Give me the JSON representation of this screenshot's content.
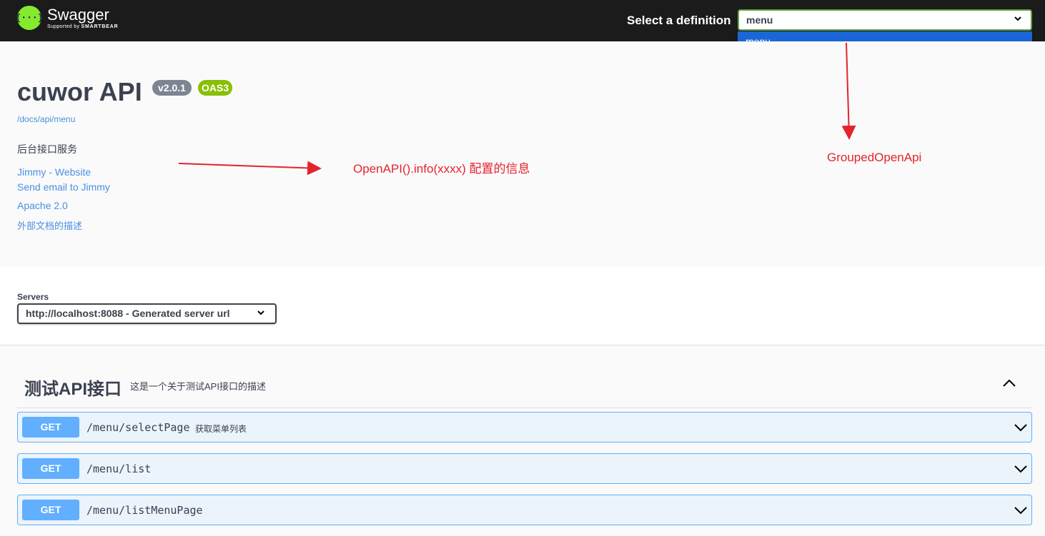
{
  "topbar": {
    "logo_title": "Swagger",
    "logo_sub_prefix": "Supported by",
    "logo_sub_brand": "SMARTBEAR",
    "logo_glyph": "{···}",
    "definition_label": "Select a definition",
    "definition_selected": "menu",
    "definition_options": [
      "menu"
    ]
  },
  "info": {
    "title": "cuwor API",
    "version": "v2.0.1",
    "oas": "OAS3",
    "url": "/docs/api/menu",
    "description": "后台接口服务",
    "contact_website": "Jimmy - Website",
    "contact_email": "Send email to Jimmy",
    "license": "Apache 2.0",
    "external_docs": "外部文档的描述"
  },
  "servers": {
    "label": "Servers",
    "selected": "http://localhost:8088 - Generated server url"
  },
  "tag": {
    "name": "测试API接口",
    "description": "这是一个关于测试API接口的描述"
  },
  "operations": [
    {
      "method": "GET",
      "path": "/menu/selectPage",
      "summary": "获取菜单列表"
    },
    {
      "method": "GET",
      "path": "/menu/list",
      "summary": ""
    },
    {
      "method": "GET",
      "path": "/menu/listMenuPage",
      "summary": ""
    }
  ],
  "annotations": {
    "info_note": "OpenAPI().info(xxxx) 配置的信息",
    "group_note": "GroupedOpenApi"
  },
  "colors": {
    "topbar_bg": "#1b1b1b",
    "logo_green": "#85ea2d",
    "get_blue": "#61affe",
    "link_blue": "#4990e2",
    "annotation_red": "#e4242d",
    "dropdown_highlight": "#1a66d6"
  }
}
